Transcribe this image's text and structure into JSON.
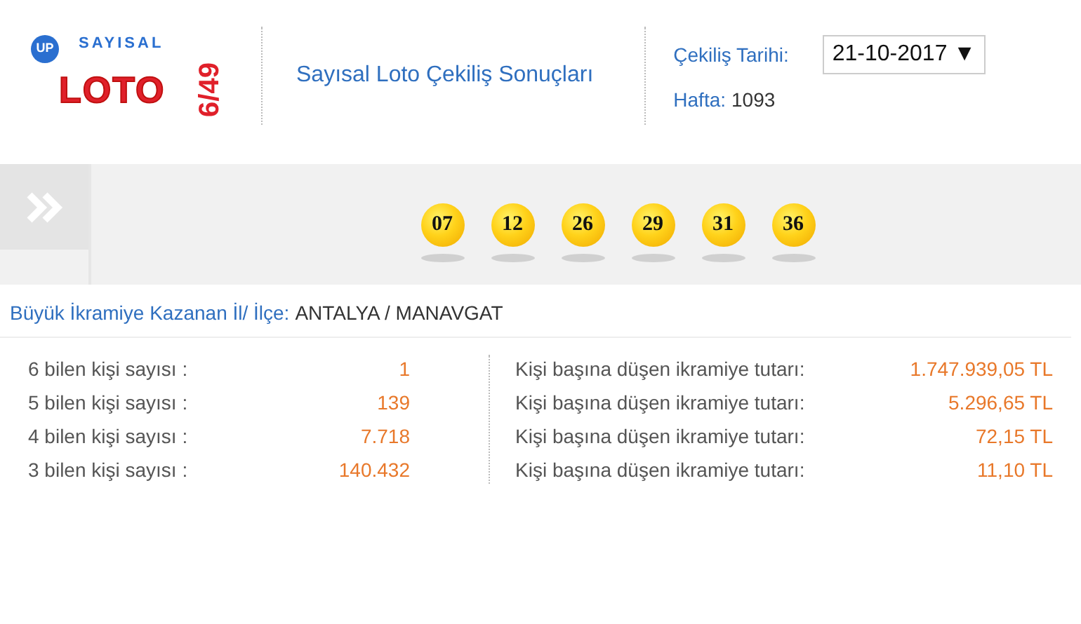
{
  "logo": {
    "badge": "UP",
    "top": "SAYISAL",
    "word": "LOTO",
    "format": "6/49"
  },
  "title": "Sayısal Loto Çekiliş Sonuçları",
  "draw_date": {
    "label": "Çekiliş Tarihi:",
    "value": "21-10-2017",
    "arrow": "▼"
  },
  "week": {
    "label": "Hafta:",
    "value": "1093"
  },
  "balls": [
    "07",
    "12",
    "26",
    "29",
    "31",
    "36"
  ],
  "winner": {
    "label": "Büyük İkramiye Kazanan İl/ İlçe:",
    "value": "ANTALYA / MANAVGAT"
  },
  "results": [
    {
      "label": "6 bilen kişi sayısı :",
      "count": "1",
      "prize_label": "Kişi başına düşen ikramiye tutarı:",
      "prize": "1.747.939,05 TL"
    },
    {
      "label": "5 bilen kişi sayısı :",
      "count": "139",
      "prize_label": "Kişi başına düşen ikramiye tutarı:",
      "prize": "5.296,65 TL"
    },
    {
      "label": "4 bilen kişi sayısı :",
      "count": "7.718",
      "prize_label": "Kişi başına düşen ikramiye tutarı:",
      "prize": "72,15 TL"
    },
    {
      "label": "3 bilen kişi sayısı :",
      "count": "140.432",
      "prize_label": "Kişi başına düşen ikramiye tutarı:",
      "prize": "11,10 TL"
    }
  ]
}
